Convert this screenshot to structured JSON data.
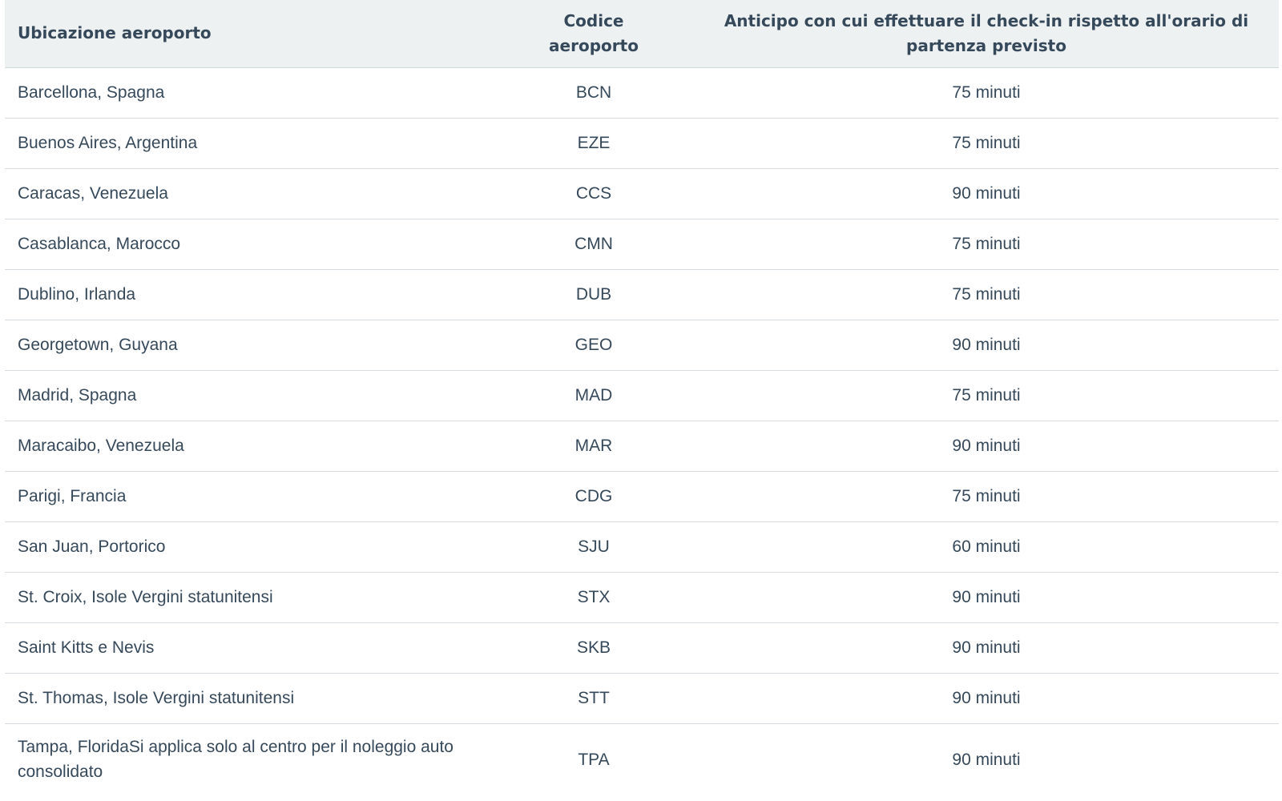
{
  "table": {
    "headers": {
      "location": "Ubicazione aeroporto",
      "code": "Codice aeroporto",
      "checkin": "Anticipo con cui effettuare il check-in rispetto all'orario di partenza previsto"
    },
    "rows": [
      {
        "location": "Barcellona, Spagna",
        "code": "BCN",
        "checkin": "75 minuti"
      },
      {
        "location": "Buenos Aires, Argentina",
        "code": "EZE",
        "checkin": "75 minuti"
      },
      {
        "location": "Caracas, Venezuela",
        "code": "CCS",
        "checkin": "90 minuti"
      },
      {
        "location": "Casablanca, Marocco",
        "code": "CMN",
        "checkin": "75 minuti"
      },
      {
        "location": "Dublino, Irlanda",
        "code": "DUB",
        "checkin": "75 minuti"
      },
      {
        "location": "Georgetown, Guyana",
        "code": "GEO",
        "checkin": "90 minuti"
      },
      {
        "location": "Madrid, Spagna",
        "code": "MAD",
        "checkin": "75 minuti"
      },
      {
        "location": "Maracaibo, Venezuela",
        "code": "MAR",
        "checkin": "90 minuti"
      },
      {
        "location": "Parigi, Francia",
        "code": "CDG",
        "checkin": "75 minuti"
      },
      {
        "location": "San Juan, Portorico",
        "code": "SJU",
        "checkin": "60 minuti"
      },
      {
        "location": "St. Croix, Isole Vergini statunitensi",
        "code": "STX",
        "checkin": "90 minuti"
      },
      {
        "location": "Saint Kitts e Nevis",
        "code": "SKB",
        "checkin": "90 minuti"
      },
      {
        "location": "St. Thomas, Isole Vergini statunitensi",
        "code": "STT",
        "checkin": "90 minuti"
      },
      {
        "location": "Tampa, FloridaSi applica solo al centro per il noleggio auto consolidato",
        "code": "TPA",
        "checkin": "90 minuti"
      }
    ]
  }
}
